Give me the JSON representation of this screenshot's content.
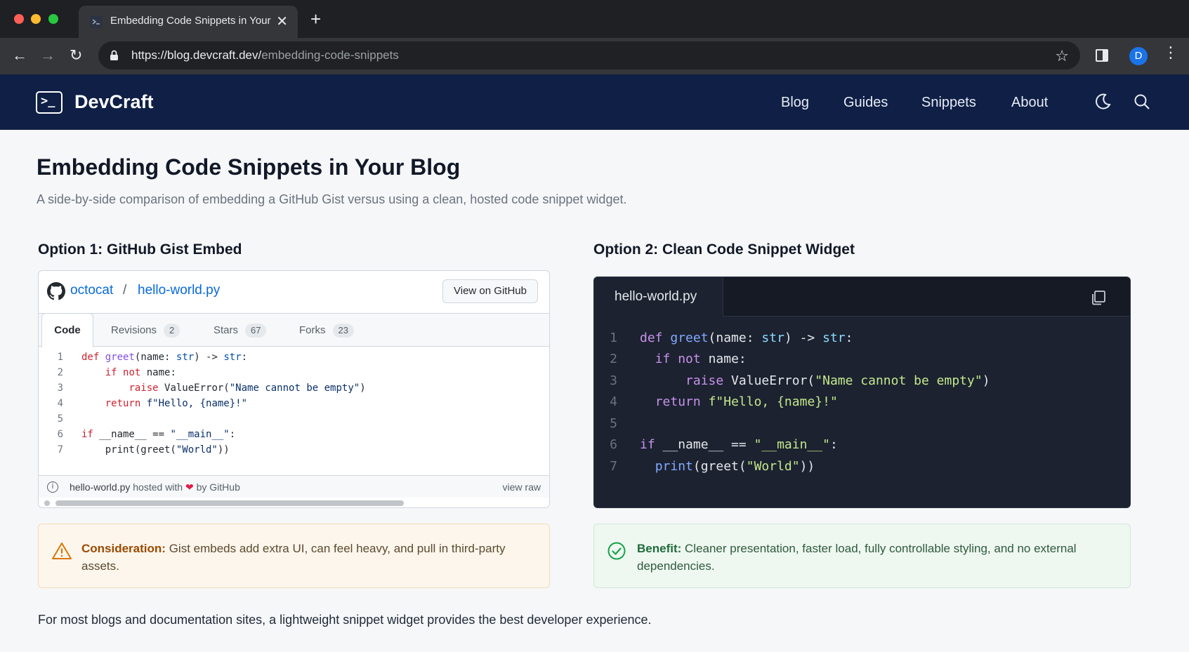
{
  "browser": {
    "tab_title": "Embedding Code Snippets in Your Blog",
    "tab_close": "✕",
    "new_tab": "+",
    "url_host": "https://blog.devcraft.dev/",
    "url_path": "embedding-code-snippets",
    "profile_initial": "D",
    "back": "←",
    "forward": "→",
    "reload": "↻",
    "bookmark": "☆",
    "menu": "⋮"
  },
  "site": {
    "brand": "DevCraft",
    "logo_glyph": ">_",
    "nav": [
      "Blog",
      "Guides",
      "Snippets",
      "About"
    ]
  },
  "article": {
    "title": "Embedding Code Snippets in Your Blog",
    "subtitle": "A side-by-side comparison of embedding a GitHub Gist versus using a clean, hosted code snippet widget.",
    "option1_heading": "Option 1: GitHub Gist Embed",
    "option2_heading": "Option 2: Clean Code Snippet Widget",
    "closing": "For most blogs and documentation sites, a lightweight snippet widget provides the best developer experience."
  },
  "gist": {
    "owner": "octocat",
    "separator": "/",
    "filename": "hello-world.py",
    "view_button": "View on GitHub",
    "tabs": [
      {
        "label": "Code",
        "count": ""
      },
      {
        "label": "Revisions",
        "count": "2"
      },
      {
        "label": "Stars",
        "count": "67"
      },
      {
        "label": "Forks",
        "count": "23"
      }
    ],
    "footer_file": "hello-world.py",
    "footer_hosted": "hosted with",
    "footer_heart": "❤",
    "footer_by": "by GitHub",
    "footer_raw": "view raw",
    "info_glyph": "i"
  },
  "code": {
    "line_numbers": [
      "1",
      "2",
      "3",
      "4",
      "5",
      "6",
      "7"
    ],
    "lines": [
      "def greet(name: str) -> str:",
      "    if not name:",
      "        raise ValueError(\"Name cannot be empty\")",
      "    return f\"Hello, {name}!\"",
      "",
      "if __name__ == \"__main__\":",
      "    print(greet(\"World\"))"
    ]
  },
  "widget": {
    "filename": "hello-world.py"
  },
  "callouts": {
    "consideration_lead": "Consideration:",
    "consideration_text": "Gist embeds add extra UI, can feel heavy, and pull in third-party assets.",
    "benefit_lead": "Benefit:",
    "benefit_text": "Cleaner presentation, faster load, fully controllable styling, and no external dependencies."
  },
  "colors": {
    "header_bg": "#0f1f45",
    "widget_bg": "#1c2230",
    "link": "#0969da",
    "warn_accent": "#d97706",
    "ok_accent": "#16a34a"
  }
}
